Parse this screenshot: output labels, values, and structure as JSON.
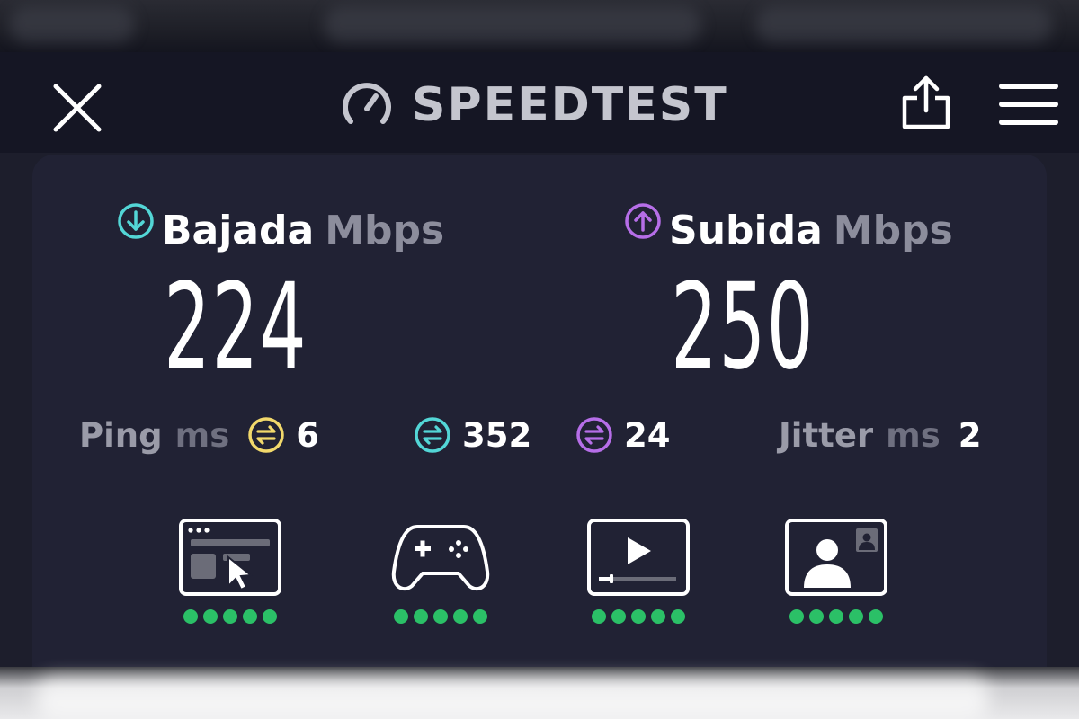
{
  "header": {
    "title": "SPEEDTEST",
    "close_icon": "close-icon",
    "logo_icon": "speedometer-icon",
    "share_icon": "share-icon",
    "menu_icon": "hamburger-menu-icon"
  },
  "download": {
    "label": "Bajada",
    "unit": "Mbps",
    "value": "224",
    "icon": "download-arrow-icon",
    "color": "#53d6d6"
  },
  "upload": {
    "label": "Subida",
    "unit": "Mbps",
    "value": "250",
    "icon": "upload-arrow-icon",
    "color": "#b66ee8"
  },
  "ping": {
    "label": "Ping",
    "unit": "ms",
    "idle": {
      "value": "6",
      "color": "#f2d96b",
      "icon": "idle-latency-icon"
    },
    "download": {
      "value": "352",
      "color": "#53d6d6",
      "icon": "download-latency-icon"
    },
    "upload": {
      "value": "24",
      "color": "#b66ee8",
      "icon": "upload-latency-icon"
    }
  },
  "jitter": {
    "label": "Jitter",
    "unit": "ms",
    "value": "2"
  },
  "use_cases": [
    {
      "icon": "web-browsing-icon",
      "rating": 5
    },
    {
      "icon": "gaming-controller-icon",
      "rating": 5
    },
    {
      "icon": "video-streaming-icon",
      "rating": 5
    },
    {
      "icon": "video-chat-icon",
      "rating": 5
    }
  ],
  "colors": {
    "rating_dot": "#2bc067",
    "card_bg": "#212234",
    "header_bg": "#151624"
  }
}
